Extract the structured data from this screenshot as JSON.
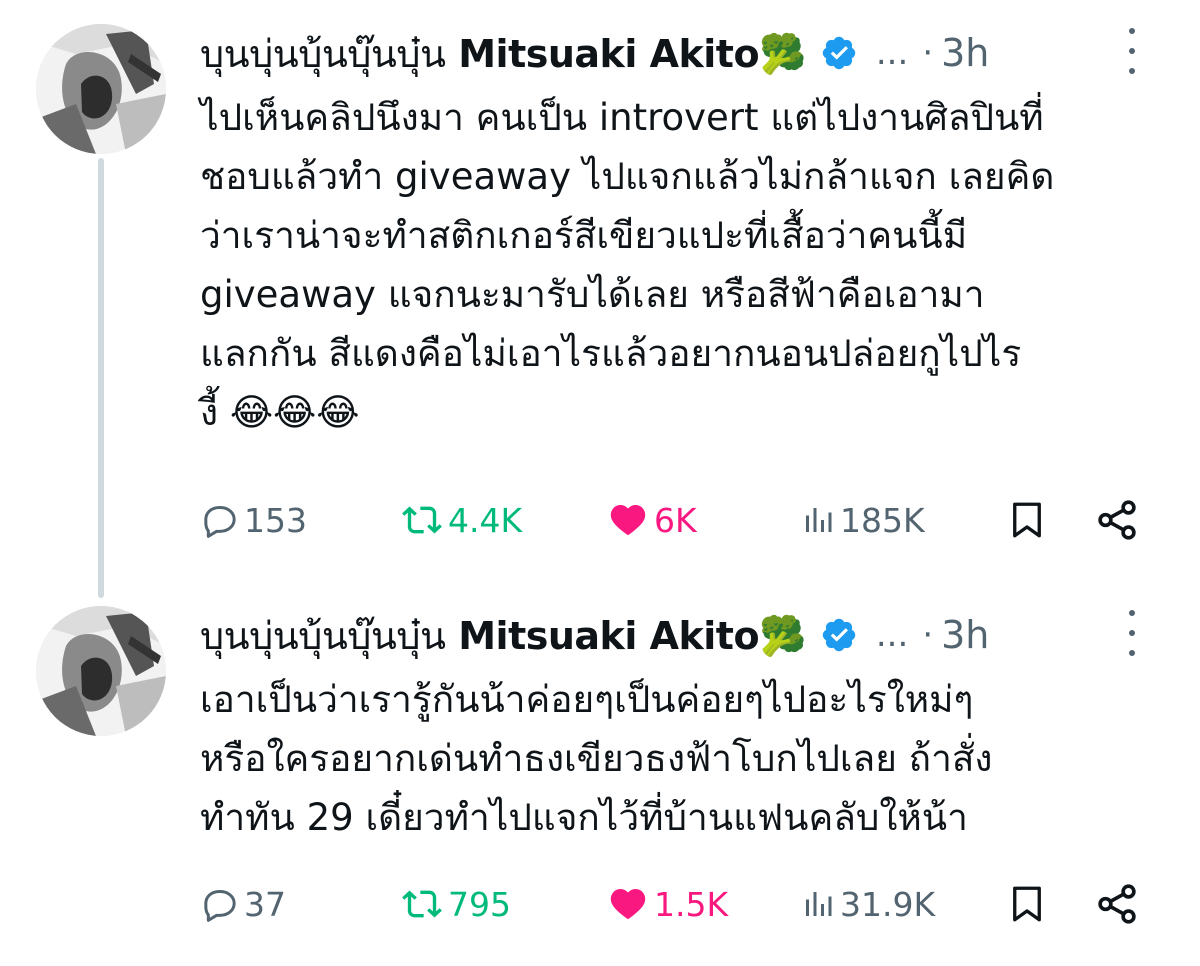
{
  "tweets": [
    {
      "author": {
        "display_name_thai": "บุนบุ่นบุ้นบุ๊นบุ๋น",
        "display_name_latin": "Mitsuaki Akito🥦",
        "handle": "...",
        "verified": true
      },
      "time": "3h",
      "text": "ไปเห็นคลิปนึงมา คนเป็น introvert แต่ไปงานศิลปินที่\nชอบแล้วทำ giveaway ไปแจกแล้วไม่กล้าแจก เลยคิด\nว่าเราน่าจะทำสติกเกอร์สีเขียวแปะที่เสื้อว่าคนนี้มี\ngiveaway แจกนะมารับได้เลย หรือสีฟ้าคือเอามา\nแลกกัน สีแดงคือไม่เอาไรแล้วอยากนอนปล่อยกูไปไร\nงี้ 😂😂😂",
      "stats": {
        "replies": "153",
        "retweets": "4.4K",
        "likes": "6K",
        "views": "185K"
      }
    },
    {
      "author": {
        "display_name_thai": "บุนบุ่นบุ้นบุ๊นบุ๋น",
        "display_name_latin": "Mitsuaki Akito🥦",
        "handle": "...",
        "verified": true
      },
      "time": "3h",
      "text": "เอาเป็นว่าเรารู้กันน้าค่อยๆเป็นค่อยๆไปอะไรใหม่ๆ\nหรือใครอยากเด่นทำธงเขียวธงฟ้าโบกไปเลย ถ้าสั่ง\nทำทัน 29 เดี๋ยวทำไปแจกไว้ที่บ้านแฟนคลับให้น้า",
      "stats": {
        "replies": "37",
        "retweets": "795",
        "likes": "1.5K",
        "views": "31.9K"
      }
    }
  ],
  "icons": {
    "reply": "speech-bubble-icon",
    "retweet": "retweet-arrows-icon",
    "like": "heart-icon",
    "views": "bar-chart-icon",
    "bookmark": "bookmark-icon",
    "share": "share-nodes-icon",
    "more": "vertical-dots-icon",
    "verified": "verified-badge-icon"
  },
  "colors": {
    "text": "#0f1419",
    "secondary": "#536471",
    "retweet": "#00ba7c",
    "like": "#f91880",
    "verified": "#1d9bf0",
    "thread_line": "#cfd9de"
  }
}
